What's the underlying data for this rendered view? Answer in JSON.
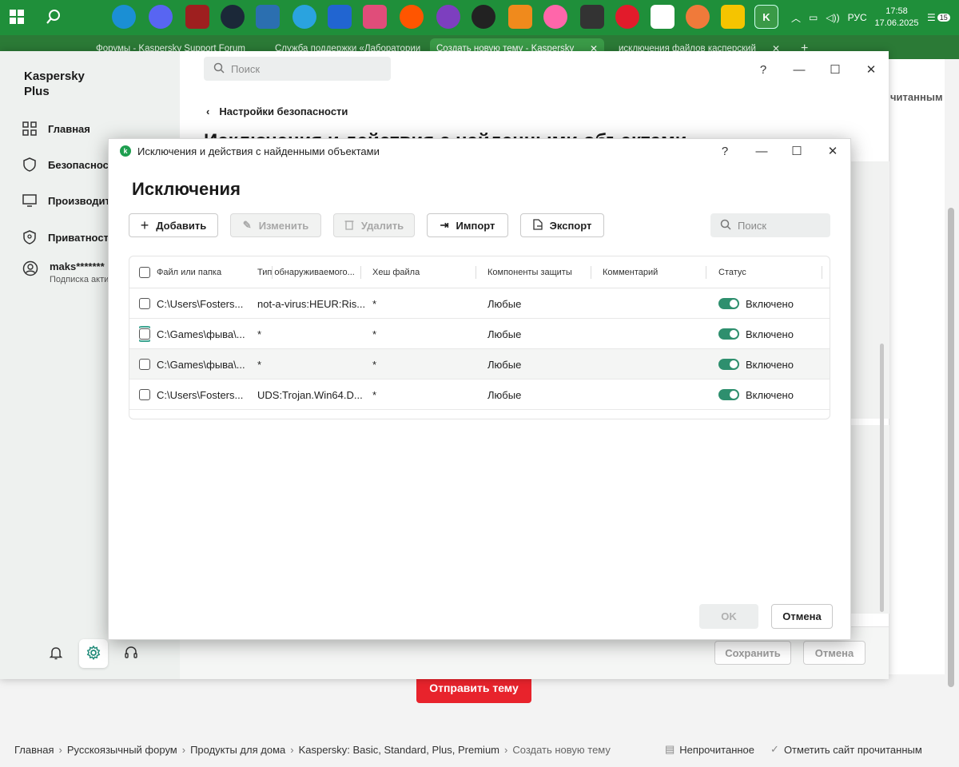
{
  "taskbar": {
    "clock_time": "17:58",
    "clock_date": "17.06.2025",
    "language": "РУС",
    "notification_count": "15",
    "icons": [
      "windows-start-icon",
      "search-icon",
      "edge-icon",
      "discord-icon",
      "dota-icon",
      "steam-icon",
      "monitor-icon",
      "telegram-icon",
      "app-icon",
      "photo-app-icon",
      "soundcloud-icon",
      "tor-icon",
      "obs-icon",
      "fl-studio-icon",
      "osu-icon",
      "game-icon",
      "opera-icon",
      "roblox-icon",
      "swirl-icon",
      "rockstar-icon",
      "kaspersky-icon"
    ]
  },
  "browser": {
    "tabs": [
      {
        "label": "Форумы - Kaspersky Support Forum"
      },
      {
        "label": "Служба поддержки «Лаборатории"
      },
      {
        "label": "Создать новую тему - Kaspersky"
      },
      {
        "label": "исключения файлов касперский"
      }
    ]
  },
  "forum": {
    "right_text": "читанным",
    "send_button": "Отправить тему",
    "breadcrumbs": [
      "Главная",
      "Русскоязычный форум",
      "Продукты для дома",
      "Kaspersky: Basic, Standard, Plus, Premium"
    ],
    "current": "Создать новую тему",
    "unread": "Непрочитанное",
    "mark_read": "Отметить сайт прочитанным"
  },
  "kapp": {
    "brand": "Kaspersky Plus",
    "search_placeholder": "Поиск",
    "nav": [
      {
        "label": "Главная"
      },
      {
        "label": "Безопасность"
      },
      {
        "label": "Производительность"
      },
      {
        "label": "Приватность"
      }
    ],
    "user_name": "maks*******",
    "user_sub": "Подписка активна",
    "back_label": "Настройки безопасности",
    "page_title": "Исключения и действия с найденными объектами",
    "save_button": "Сохранить",
    "cancel_button": "Отмена"
  },
  "dialog": {
    "window_title": "Исключения и действия с найденными объектами",
    "heading": "Исключения",
    "toolbar": {
      "add": "Добавить",
      "edit": "Изменить",
      "delete": "Удалить",
      "import": "Импорт",
      "export": "Экспорт",
      "search_placeholder": "Поиск"
    },
    "columns": [
      "Файл или папка",
      "Тип обнаруживаемого...",
      "Хеш файла",
      "Компоненты защиты",
      "Комментарий",
      "Статус"
    ],
    "rows": [
      {
        "path": "C:\\Users\\Fosters...",
        "type": "not-a-virus:HEUR:Ris...",
        "hash": "*",
        "components": "Любые",
        "comment": "",
        "status": "Включено"
      },
      {
        "path": "C:\\Games\\фыва\\...",
        "type": "*",
        "hash": "*",
        "components": "Любые",
        "comment": "",
        "status": "Включено"
      },
      {
        "path": "C:\\Games\\фыва\\...",
        "type": "*",
        "hash": "*",
        "components": "Любые",
        "comment": "",
        "status": "Включено"
      },
      {
        "path": "C:\\Users\\Fosters...",
        "type": "UDS:Trojan.Win64.D...",
        "hash": "*",
        "components": "Любые",
        "comment": "",
        "status": "Включено"
      }
    ],
    "ok_button": "OK",
    "cancel_button": "Отмена"
  }
}
